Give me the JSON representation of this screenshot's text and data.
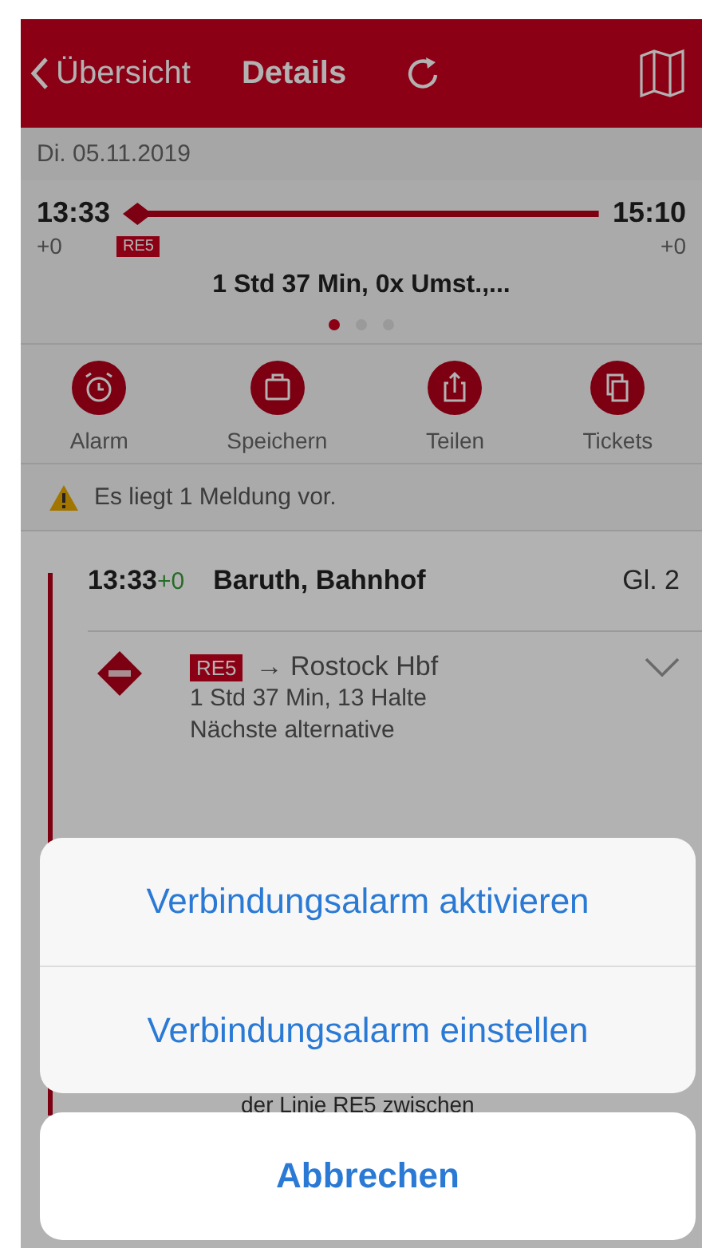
{
  "nav": {
    "back": "Übersicht",
    "title": "Details"
  },
  "date": "Di. 05.11.2019",
  "summary": {
    "dep_time": "13:33",
    "dep_delay": "+0",
    "arr_time": "15:10",
    "arr_delay": "+0",
    "line": "RE5",
    "duration": "1 Std 37 Min,  0x Umst.,..."
  },
  "pages": [
    {
      "selected": true
    },
    {
      "selected": false
    },
    {
      "selected": false
    }
  ],
  "actions": [
    {
      "kind": "alarm",
      "label": "Alarm"
    },
    {
      "kind": "save",
      "label": "Speichern"
    },
    {
      "kind": "share",
      "label": "Teilen"
    },
    {
      "kind": "tickets",
      "label": "Tickets"
    }
  ],
  "notice": "Es liegt 1 Meldung vor.",
  "stop": {
    "time": "13:33",
    "delay": "+0",
    "name": "Baruth, Bahnhof",
    "platform": "Gl. 2"
  },
  "leg": {
    "line": "RE5",
    "direction": "→ Rostock Hbf",
    "info": "1 Std 37 Min, 13 Halte",
    "alt": "Nächste alternative",
    "remark": "der Linie RE5 zwischen"
  },
  "sheet": {
    "options": [
      "Verbindungsalarm aktivieren",
      "Verbindungsalarm einstellen"
    ],
    "cancel": "Abbrechen"
  }
}
